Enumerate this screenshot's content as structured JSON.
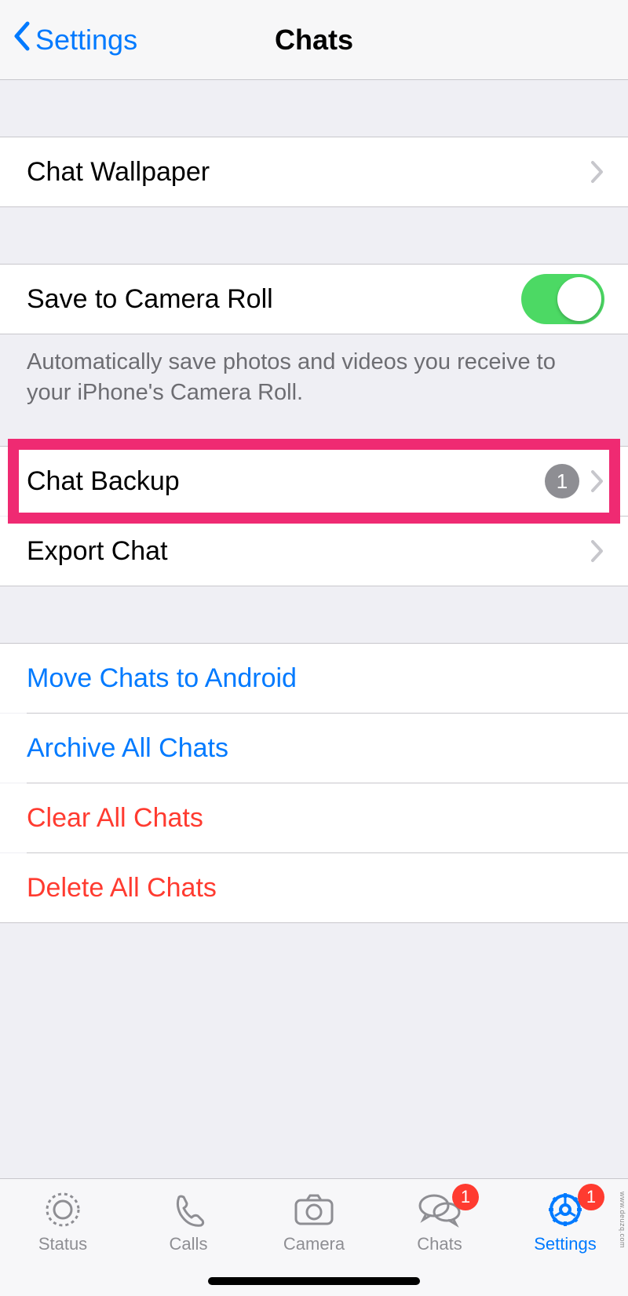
{
  "navbar": {
    "back": "Settings",
    "title": "Chats"
  },
  "groups": {
    "wallpaper": {
      "label": "Chat Wallpaper"
    },
    "cameraRoll": {
      "label": "Save to Camera Roll",
      "footer": "Automatically save photos and videos you receive to your iPhone's Camera Roll."
    },
    "backup": {
      "label": "Chat Backup",
      "badge": "1"
    },
    "export": {
      "label": "Export Chat"
    },
    "actions": {
      "move": "Move Chats to Android",
      "archive": "Archive All Chats",
      "clear": "Clear All Chats",
      "delete": "Delete All Chats"
    }
  },
  "tabs": {
    "status": "Status",
    "calls": "Calls",
    "camera": "Camera",
    "chats": "Chats",
    "chats_badge": "1",
    "settings": "Settings",
    "settings_badge": "1"
  },
  "watermark": "www.deuzq.com"
}
